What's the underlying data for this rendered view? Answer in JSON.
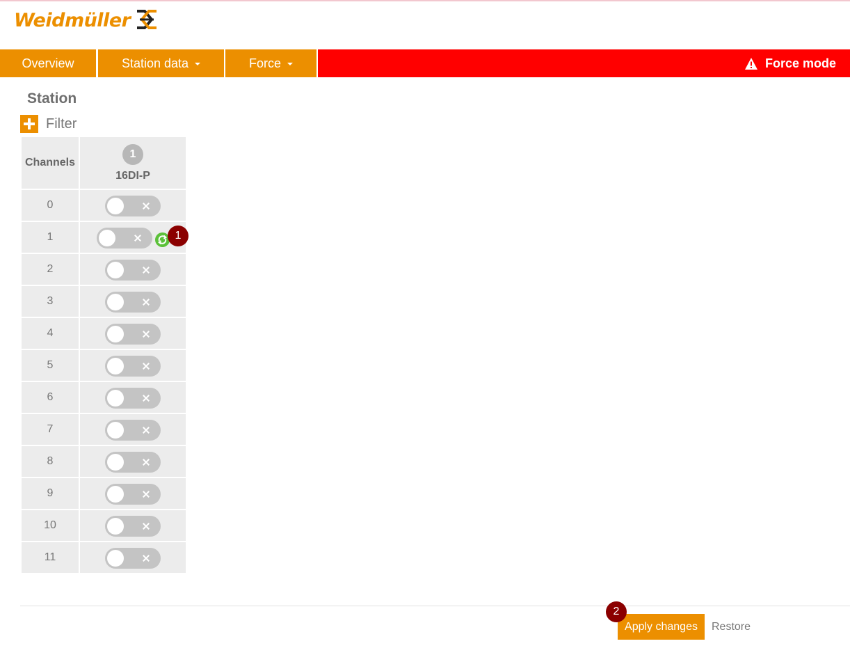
{
  "brand": {
    "name": "Weidmüller",
    "color": "#ec8f00",
    "mark_icon": "weidmuller-logo-mark-icon"
  },
  "nav": {
    "items": [
      {
        "label": "Overview"
      },
      {
        "label": "Station data",
        "dropdown": true
      },
      {
        "label": "Force",
        "dropdown": true
      }
    ],
    "force_mode": {
      "label": "Force mode",
      "icon": "warning-icon",
      "color": "#ff0000"
    }
  },
  "page": {
    "title": "Station",
    "filter_label": "Filter",
    "filter_icon": "plus-icon"
  },
  "table": {
    "channels_header": "Channels",
    "module": {
      "slot": "1",
      "name": "16DI-P"
    },
    "rows": [
      {
        "channel": "0",
        "forced": false
      },
      {
        "channel": "1",
        "forced": false,
        "changed": true
      },
      {
        "channel": "2",
        "forced": false
      },
      {
        "channel": "3",
        "forced": false
      },
      {
        "channel": "4",
        "forced": false
      },
      {
        "channel": "5",
        "forced": false
      },
      {
        "channel": "6",
        "forced": false
      },
      {
        "channel": "7",
        "forced": false
      },
      {
        "channel": "8",
        "forced": false
      },
      {
        "channel": "9",
        "forced": false
      },
      {
        "channel": "10",
        "forced": false
      },
      {
        "channel": "11",
        "forced": false
      }
    ]
  },
  "markers": [
    "1",
    "2"
  ],
  "actions": {
    "apply_label": "Apply changes",
    "restore_label": "Restore"
  },
  "colors": {
    "accent": "#ec8f00",
    "alert": "#ff0000",
    "marker": "#8b0000",
    "changed_icon": "#5cc13a"
  }
}
